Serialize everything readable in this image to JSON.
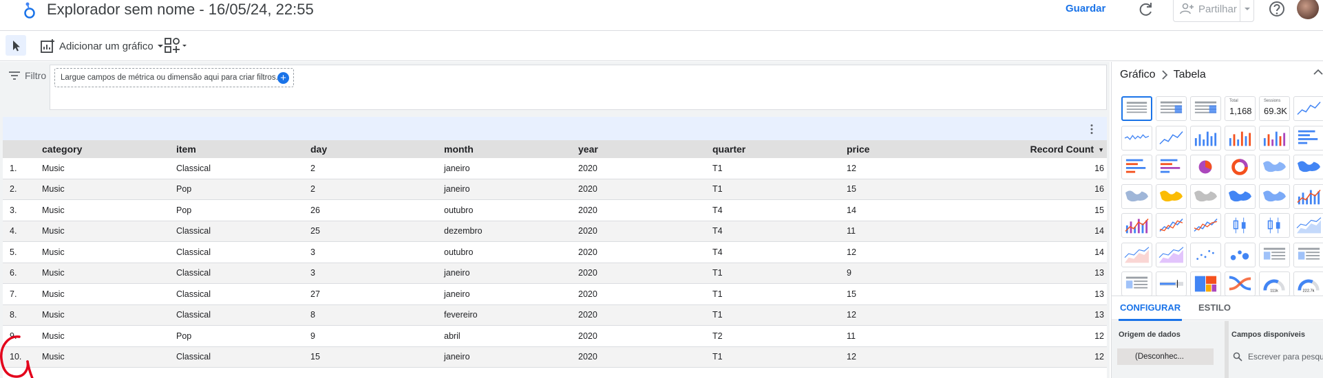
{
  "header": {
    "title": "Explorador sem nome - 16/05/24, 22:55",
    "save_label": "Guardar",
    "share_label": "Partilhar",
    "colors": {
      "accent": "#1a73e8"
    }
  },
  "toolbar": {
    "add_chart_label": "Adicionar um gráfico"
  },
  "filter": {
    "label": "Filtro",
    "drop_zone_text": "Largue campos de métrica ou dimensão aqui para criar filtros."
  },
  "table": {
    "columns": [
      "category",
      "item",
      "day",
      "month",
      "year",
      "quarter",
      "price",
      "Record Count"
    ],
    "rows": [
      [
        "1.",
        "Music",
        "Classical",
        "2",
        "janeiro",
        "2020",
        "T1",
        "12",
        "16"
      ],
      [
        "2.",
        "Music",
        "Pop",
        "2",
        "janeiro",
        "2020",
        "T1",
        "15",
        "16"
      ],
      [
        "3.",
        "Music",
        "Pop",
        "26",
        "outubro",
        "2020",
        "T4",
        "14",
        "15"
      ],
      [
        "4.",
        "Music",
        "Classical",
        "25",
        "dezembro",
        "2020",
        "T4",
        "11",
        "14"
      ],
      [
        "5.",
        "Music",
        "Classical",
        "3",
        "outubro",
        "2020",
        "T4",
        "12",
        "14"
      ],
      [
        "6.",
        "Music",
        "Classical",
        "3",
        "janeiro",
        "2020",
        "T1",
        "9",
        "13"
      ],
      [
        "7.",
        "Music",
        "Classical",
        "27",
        "janeiro",
        "2020",
        "T1",
        "15",
        "13"
      ],
      [
        "8.",
        "Music",
        "Classical",
        "8",
        "fevereiro",
        "2020",
        "T1",
        "12",
        "13"
      ],
      [
        "9.",
        "Music",
        "Pop",
        "9",
        "abril",
        "2020",
        "T2",
        "11",
        "12"
      ],
      [
        "10.",
        "Music",
        "Classical",
        "15",
        "janeiro",
        "2020",
        "T1",
        "12",
        "12"
      ]
    ]
  },
  "panel": {
    "breadcrumb_root": "Gráfico",
    "breadcrumb_current": "Tabela",
    "scorecards": [
      {
        "label": "Total",
        "value": "1,168"
      },
      {
        "label": "Sessions",
        "value": "69.3K"
      }
    ],
    "tabs": [
      "CONFIGURAR",
      "ESTILO"
    ],
    "data_source_title": "Origem de dados",
    "data_source_value": "(Desconhec...",
    "available_fields_title": "Campos disponíveis",
    "search_placeholder": "Escrever para pesqu"
  }
}
